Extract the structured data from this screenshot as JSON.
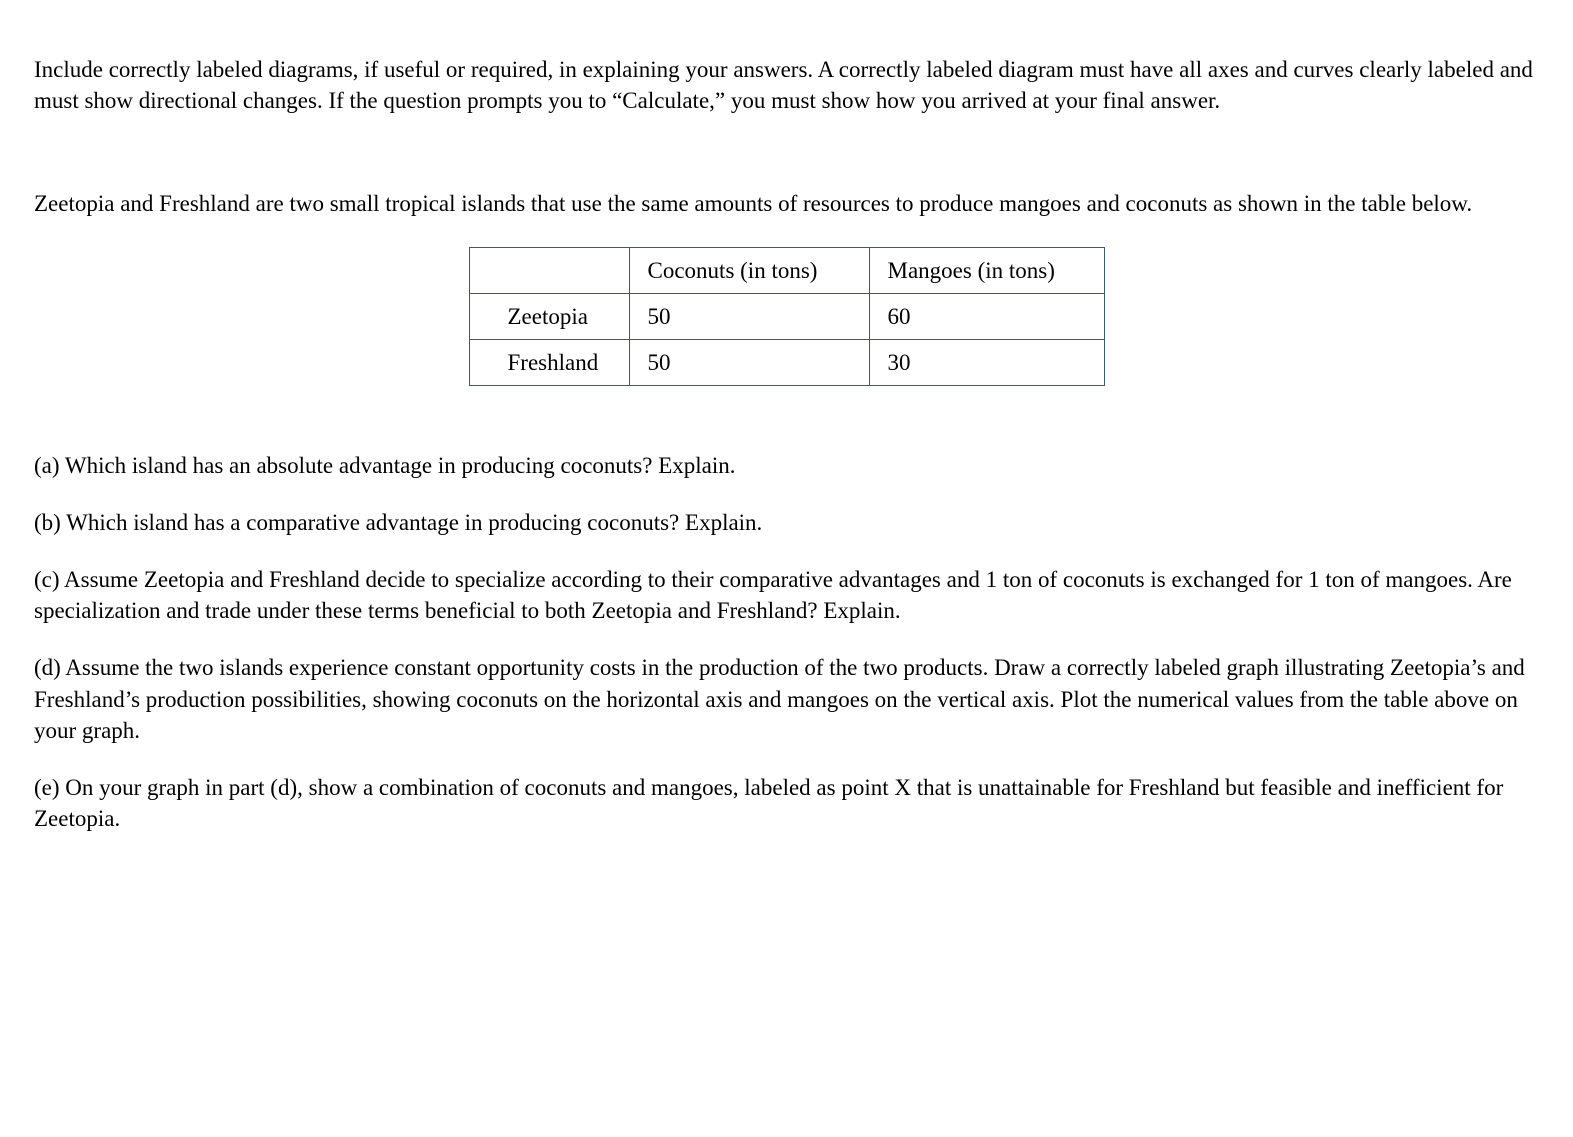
{
  "instructions": "Include correctly labeled diagrams, if useful or required, in explaining your answers. A correctly labeled diagram must have all axes and curves clearly labeled and must show directional changes. If the question prompts you to “Calculate,” you must show how you arrived at your final answer.",
  "setup": "Zeetopia and Freshland are two small tropical islands that use the same amounts of resources to produce mangoes and coconuts as shown in the table below.",
  "table": {
    "headers": {
      "blank": "",
      "coconuts": "Coconuts (in tons)",
      "mangoes": "Mangoes (in tons)"
    },
    "rows": [
      {
        "label": "Zeetopia",
        "coconuts": "50",
        "mangoes": "60"
      },
      {
        "label": "Freshland",
        "coconuts": "50",
        "mangoes": "30"
      }
    ]
  },
  "questions": {
    "a": "(a) Which island has an absolute advantage in producing coconuts? Explain.",
    "b": "(b) Which island has a comparative advantage in producing coconuts? Explain.",
    "c": "(c) Assume Zeetopia and Freshland decide to specialize according to their comparative advantages and 1 ton of coconuts is exchanged for 1 ton of mangoes. Are specialization and trade under these terms beneficial to both Zeetopia and Freshland? Explain.",
    "d": "(d) Assume the two islands experience constant opportunity costs in the production of the two products. Draw a correctly labeled graph illustrating Zeetopia’s and Freshland’s production possibilities, showing coconuts on the horizontal axis and mangoes on the vertical axis. Plot the numerical values from the table above on your graph.",
    "e": "(e) On your graph in part (d), show a combination of coconuts and mangoes, labeled as point X that is unattainable for Freshland but feasible and inefficient for Zeetopia."
  }
}
